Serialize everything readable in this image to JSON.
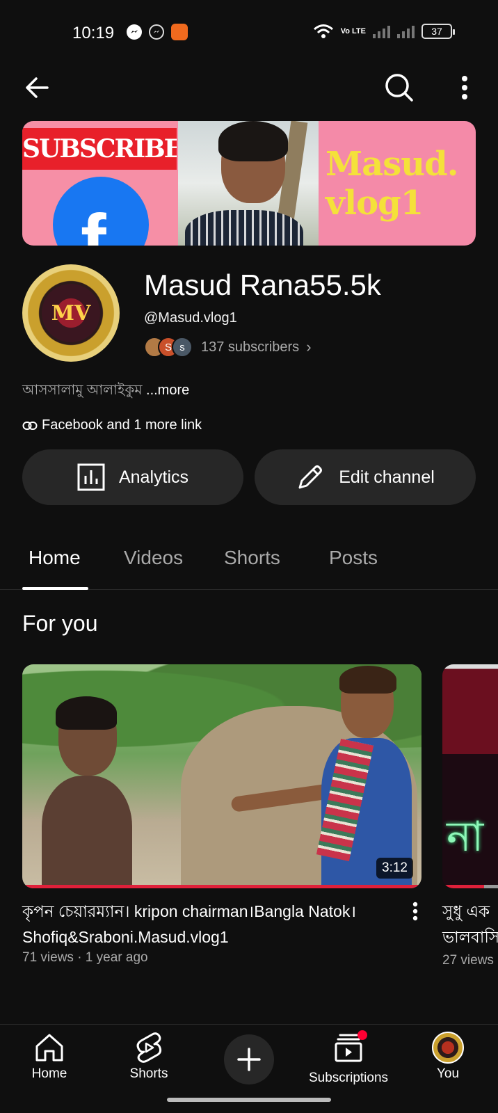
{
  "status_bar": {
    "time": "10:19",
    "network": "Vo LTE",
    "battery": "37"
  },
  "top_bar": {
    "back_icon": "arrow-left-icon",
    "search_icon": "search-icon",
    "more_icon": "more-vert-icon"
  },
  "banner": {
    "subscribe_text": "SUBSCRIBE",
    "brand_line1": "Masud.",
    "brand_line2": "vlog1"
  },
  "channel": {
    "avatar_text": "MV",
    "name": "Masud Rana55.5k",
    "handle": "@Masud.vlog1",
    "subscribers": "137 subscribers",
    "mini_avatar_letters": [
      "S",
      "s"
    ],
    "description": "আসসালামু আলাইকুম",
    "more": "...more",
    "links": "Facebook and 1 more link"
  },
  "actions": {
    "analytics": "Analytics",
    "edit_channel": "Edit channel"
  },
  "tabs": [
    "Home",
    "Videos",
    "Shorts",
    "Posts"
  ],
  "section_title": "For you",
  "videos": [
    {
      "title": "কৃপন চেয়ারম্যান। kripon chairman।Bangla Natok। Shofiq&Sraboni.Masud.vlog1",
      "meta": "71 views · 1 year ago",
      "duration": "3:12"
    },
    {
      "title_line1": "সুধু এক",
      "title_line2": "ভালবাসি",
      "meta": "27 views",
      "thumb_text": "না"
    }
  ],
  "bottom_nav": {
    "home": "Home",
    "shorts": "Shorts",
    "subscriptions": "Subscriptions",
    "you": "You"
  },
  "colors": {
    "background": "#0f0f0f",
    "button_bg": "#272727",
    "accent_red": "#ff0033"
  }
}
